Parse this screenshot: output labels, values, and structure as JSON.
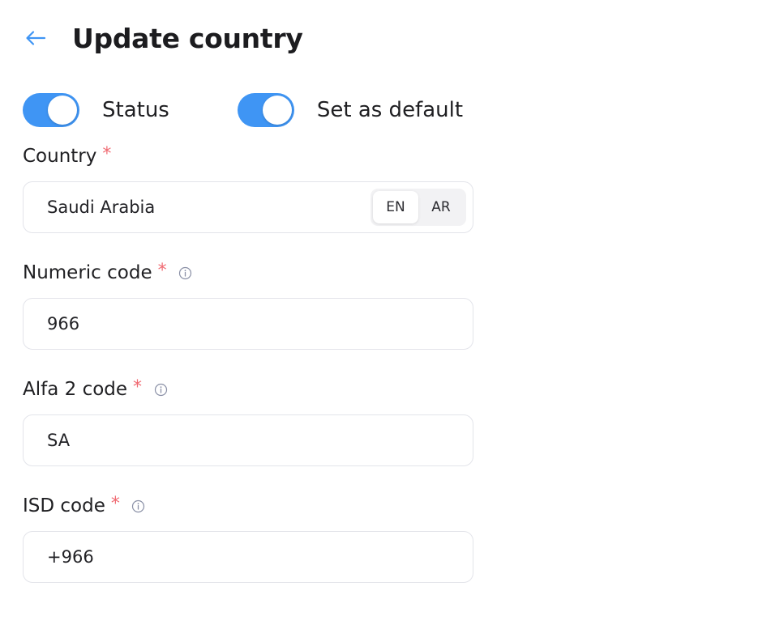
{
  "header": {
    "title": "Update country",
    "back_icon": "arrow-left-icon"
  },
  "colors": {
    "accent": "#3f95f4",
    "required": "#f06a72",
    "border": "#e3e4ea"
  },
  "toggles": {
    "status": {
      "label": "Status",
      "on": true
    },
    "default": {
      "label": "Set as default",
      "on": true
    }
  },
  "fields": {
    "country": {
      "label": "Country",
      "required_mark": "*",
      "value": "Saudi Arabia",
      "languages": [
        "EN",
        "AR"
      ],
      "active_language": "EN"
    },
    "numeric_code": {
      "label": "Numeric code",
      "required_mark": "*",
      "value": "966",
      "info_icon": "info-icon"
    },
    "alfa2_code": {
      "label": "Alfa 2 code",
      "required_mark": "*",
      "value": "SA",
      "info_icon": "info-icon"
    },
    "isd_code": {
      "label": "ISD code",
      "required_mark": "*",
      "value": "+966",
      "info_icon": "info-icon"
    }
  }
}
